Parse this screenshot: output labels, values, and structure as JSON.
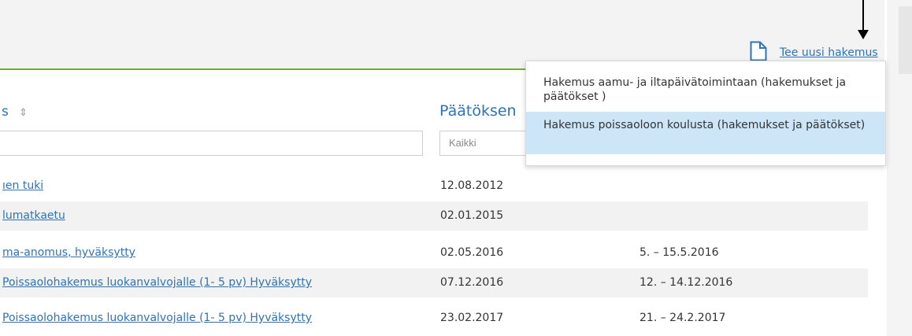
{
  "new_application": {
    "label": "Tee uusi hakemus",
    "icon": "document-icon"
  },
  "dropdown": {
    "items": [
      {
        "label": "Hakemus aamu- ja iltapäivätoimintaan (hakemukset ja päätökset )",
        "selected": false
      },
      {
        "label": "Hakemus poissaoloon koulusta (hakemukset ja päätökset)",
        "selected": true
      }
    ]
  },
  "columns": {
    "name_header": "s",
    "name_sort_icon": "sort-icon",
    "decision_header": "Päätöksen",
    "name_filter_value": "",
    "decision_filter_placeholder": "Kaikki"
  },
  "rows": [
    {
      "name": "ıen tuki",
      "date": "12.08.2012",
      "range": ""
    },
    {
      "name": "lumatkaetu",
      "date": "02.01.2015",
      "range": ""
    },
    {
      "name": "ma-anomus, hyväksytty",
      "date": "02.05.2016",
      "range": "5. – 15.5.2016"
    },
    {
      "name": "Poissaolohakemus luokanvalvojalle (1- 5 pv) Hyväksytty",
      "date": "07.12.2016",
      "range": "12. – 14.12.2016"
    },
    {
      "name": "Poissaolohakemus luokanvalvojalle (1- 5 pv) Hyväksytty",
      "date": "23.02.2017",
      "range": "21. – 24.2.2017"
    }
  ],
  "colors": {
    "link": "#2d73b8",
    "accent_line": "#6fae36",
    "selected_item": "#cde6f7"
  }
}
